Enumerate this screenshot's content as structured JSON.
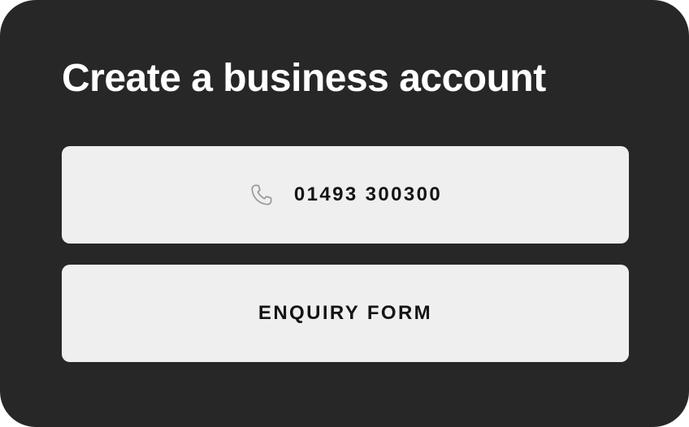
{
  "panel": {
    "title": "Create a business account",
    "phone_button": {
      "icon": "phone-icon",
      "label": "01493 300300"
    },
    "enquiry_button": {
      "label": "ENQUIRY FORM"
    }
  },
  "colors": {
    "panel_background": "#272727",
    "button_background": "#efefef",
    "title_text": "#ffffff",
    "button_text": "#141414",
    "icon": "#9a9a9a"
  }
}
